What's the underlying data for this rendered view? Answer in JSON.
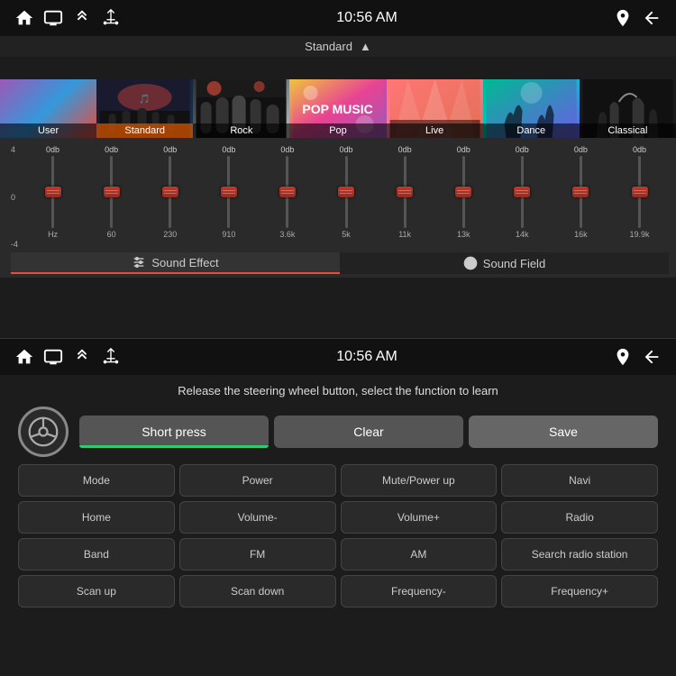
{
  "top": {
    "status_bar": {
      "time": "10:56 AM",
      "icons_left": [
        "home",
        "screen",
        "up-arrows",
        "usb"
      ],
      "icons_right": [
        "location",
        "back"
      ]
    },
    "presets_header": {
      "label": "Standard",
      "chevron": "▲"
    },
    "presets": [
      {
        "id": "user",
        "label": "User",
        "active": false
      },
      {
        "id": "standard",
        "label": "Standard",
        "active": true
      },
      {
        "id": "rock",
        "label": "Rock",
        "active": false
      },
      {
        "id": "pop",
        "label": "Pop",
        "active": false
      },
      {
        "id": "live",
        "label": "Live",
        "active": false
      },
      {
        "id": "dance",
        "label": "Dance",
        "active": false
      },
      {
        "id": "classical",
        "label": "Classical",
        "active": false
      }
    ],
    "eq": {
      "db_labels": [
        "4",
        "0",
        "-4"
      ],
      "sliders": [
        {
          "db": "0db",
          "freq": "Hz"
        },
        {
          "db": "0db",
          "freq": "60"
        },
        {
          "db": "0db",
          "freq": "230"
        },
        {
          "db": "0db",
          "freq": "910"
        },
        {
          "db": "0db",
          "freq": "3.6k"
        },
        {
          "db": "0db",
          "freq": "5k"
        },
        {
          "db": "0db",
          "freq": "11k"
        },
        {
          "db": "0db",
          "freq": "13k"
        },
        {
          "db": "0db",
          "freq": "14k"
        },
        {
          "db": "0db",
          "freq": "16k"
        },
        {
          "db": "0db",
          "freq": "19.9k"
        }
      ]
    },
    "tabs": [
      {
        "label": "Sound Effect",
        "active": true,
        "icon": "sliders"
      },
      {
        "label": "Sound Field",
        "active": false,
        "icon": "circle-dot"
      }
    ]
  },
  "bottom": {
    "status_bar": {
      "time": "10:56 AM"
    },
    "title": "Release the steering wheel button, select the function to learn",
    "controls": {
      "short_press": "Short press",
      "clear": "Clear",
      "save": "Save"
    },
    "functions": [
      "Mode",
      "Power",
      "Mute/Power up",
      "Navi",
      "Home",
      "Volume-",
      "Volume+",
      "Radio",
      "Band",
      "FM",
      "AM",
      "Search radio station",
      "Scan up",
      "Scan down",
      "Frequency-",
      "Frequency+"
    ]
  }
}
